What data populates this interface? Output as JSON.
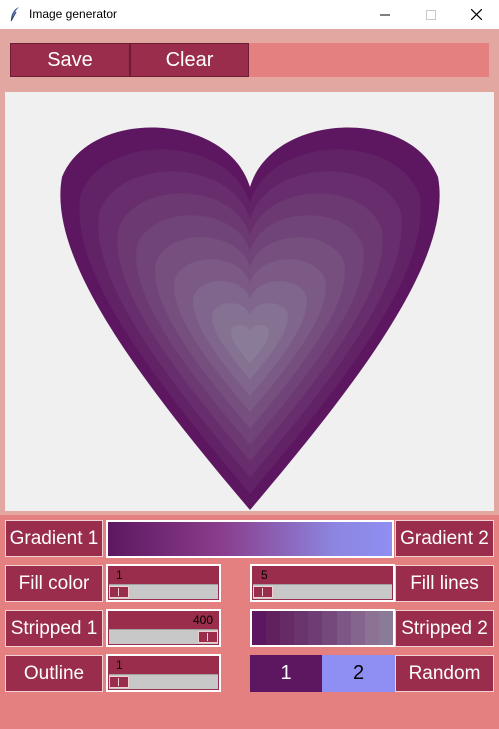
{
  "window": {
    "title": "Image generator"
  },
  "toolbar": {
    "save_label": "Save",
    "clear_label": "Clear"
  },
  "controls": {
    "gradient1_label": "Gradient 1",
    "gradient2_label": "Gradient 2",
    "fill_color_label": "Fill color",
    "fill_lines_label": "Fill lines",
    "stripped1_label": "Stripped 1",
    "stripped2_label": "Stripped 2",
    "outline_label": "Outline",
    "random_label": "Random",
    "gradient_colors": [
      "#5d1760",
      "#8f8ef2"
    ],
    "fill_color_scale": {
      "value": "1",
      "level": 0.0
    },
    "fill_lines_scale": {
      "value": "5",
      "level": 0.0
    },
    "stripped1_scale": {
      "value": "400",
      "level": 1.0
    },
    "outline_scale": {
      "value": "1",
      "level": 0.0
    },
    "stripe_colors": [
      "#5d1760",
      "#61215f",
      "#662b67",
      "#6a346d",
      "#6f3d74",
      "#75497c",
      "#7d5785",
      "#85658d",
      "#8c7395",
      "#8a7c98"
    ],
    "selector_1_label": "1",
    "selector_2_label": "2",
    "selector_1_color": "#5d1760",
    "selector_2_color": "#8f8ef2"
  },
  "heart": {
    "layers": 10,
    "outer_color": "#5d1760",
    "inner_color": "#8a7c98"
  }
}
